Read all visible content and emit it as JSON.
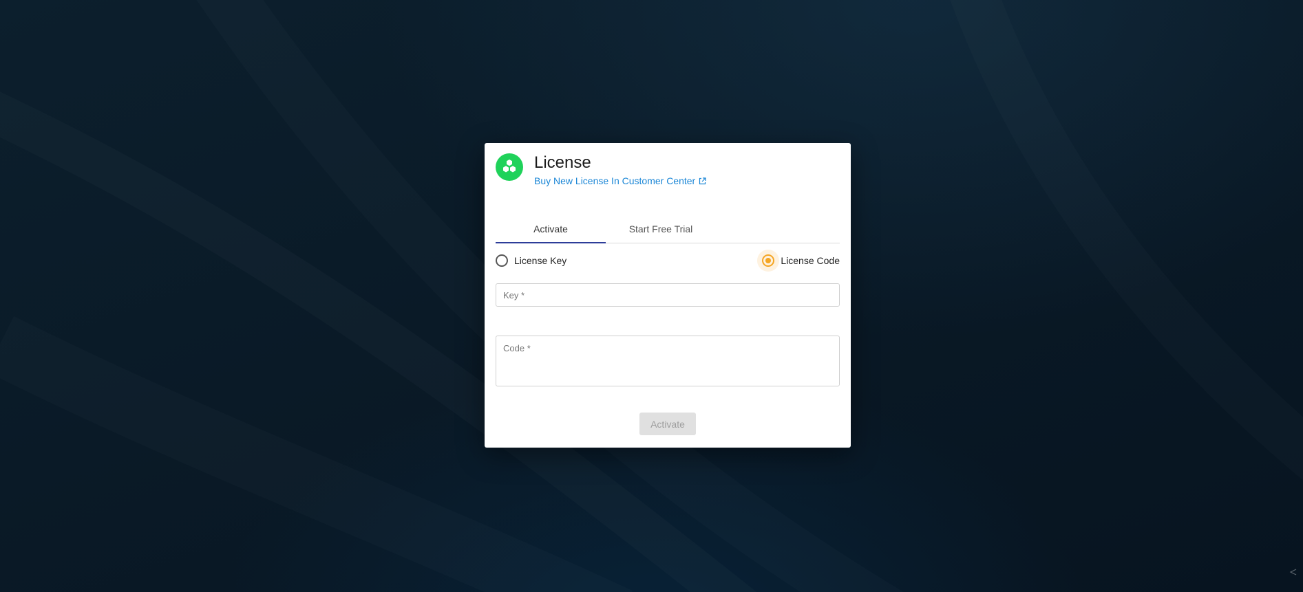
{
  "dialog": {
    "title": "License",
    "buy_link": "Buy New License In Customer Center",
    "logo_icon": "hexagon-cluster-icon",
    "link_icon": "external-link-icon",
    "colors": {
      "logo": "#1fd25a",
      "link": "#1a86d6",
      "tab_indicator": "#2d3d99",
      "radio_selected": "#f5a623"
    }
  },
  "tabs": [
    {
      "label": "Activate",
      "active": true
    },
    {
      "label": "Start Free Trial",
      "active": false
    }
  ],
  "license_type": {
    "options": [
      {
        "label": "License Key",
        "selected": false
      },
      {
        "label": "License Code",
        "selected": true
      }
    ]
  },
  "form": {
    "key_label": "Key *",
    "code_label": "Code *",
    "submit_label": "Activate",
    "submit_disabled": true
  }
}
